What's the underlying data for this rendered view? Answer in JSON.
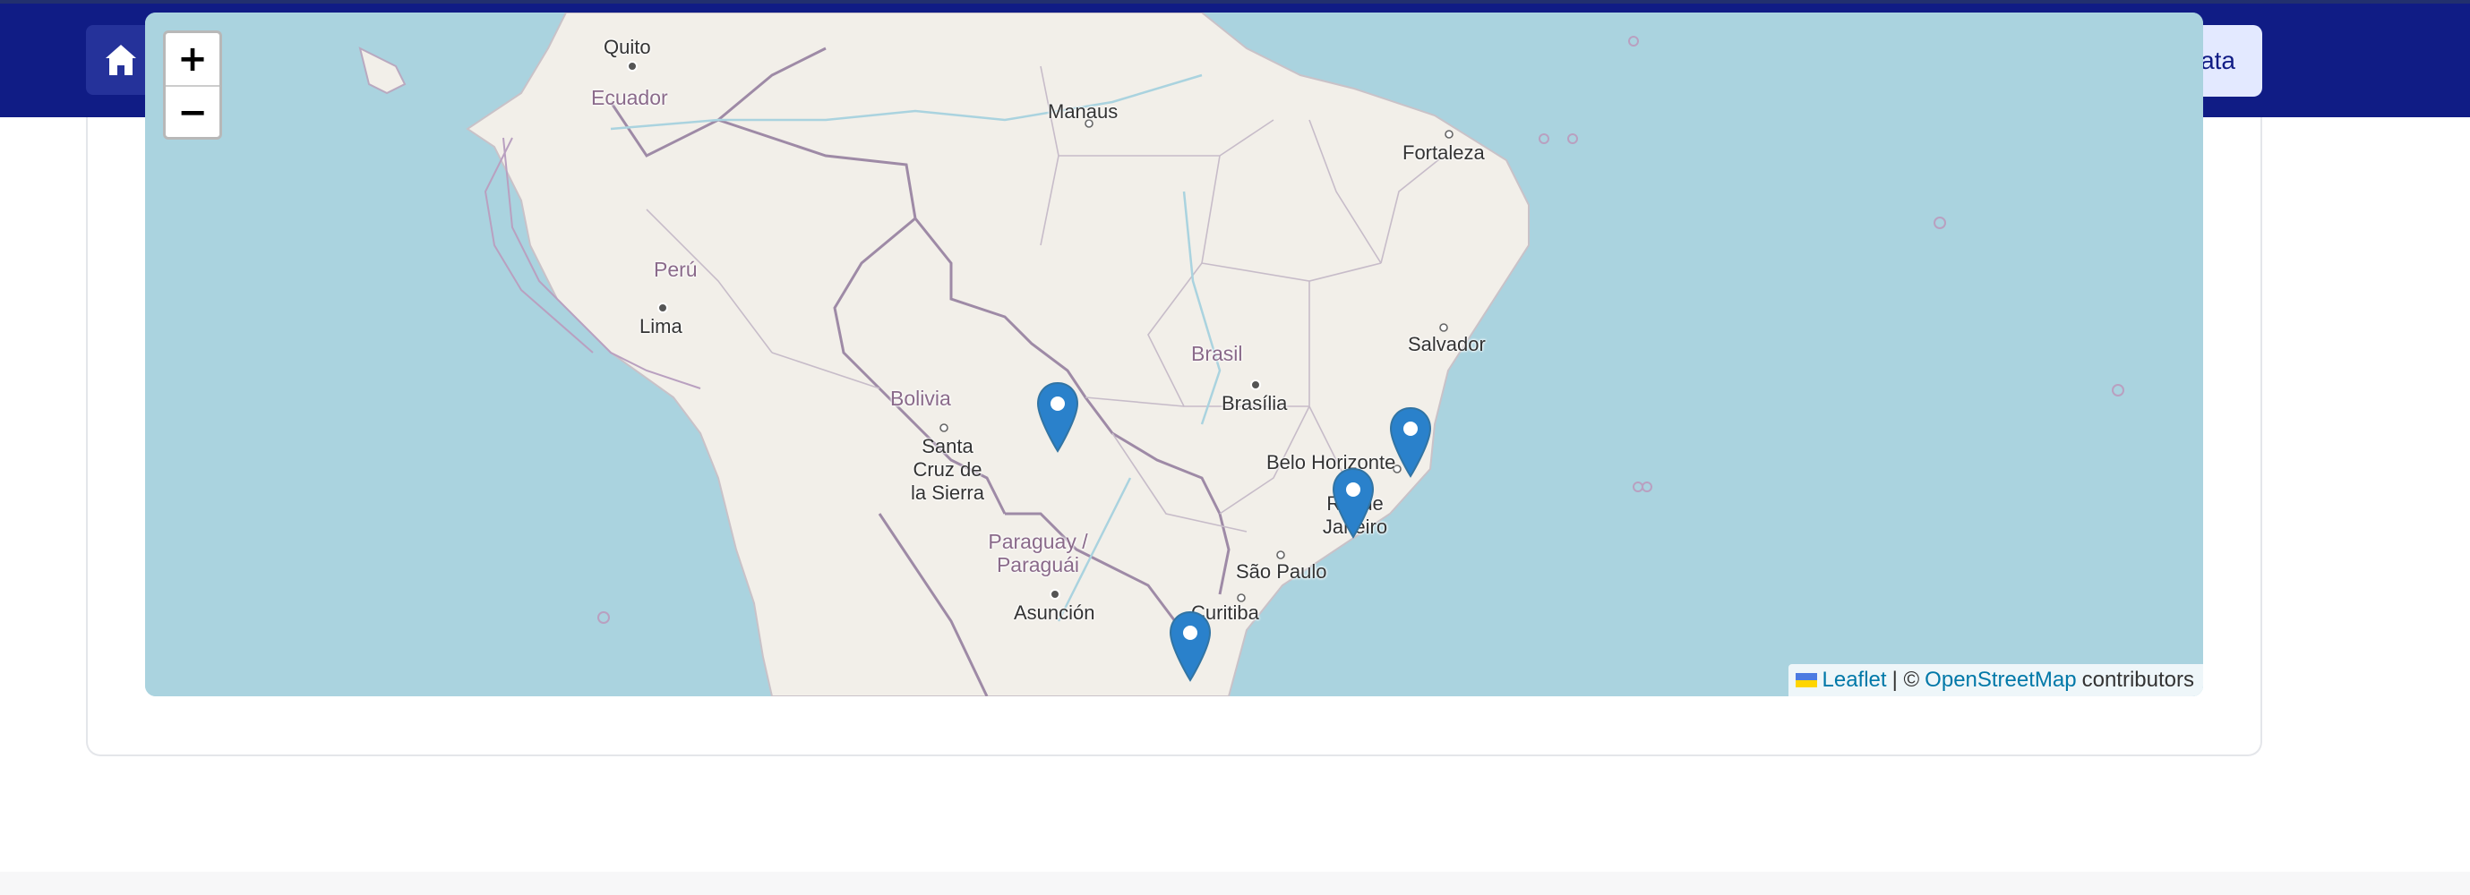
{
  "header": {
    "home_icon": "home-icon",
    "right_button_label": "ata",
    "bar_color": "#101c85"
  },
  "map": {
    "tiles": "OpenStreetMap",
    "zoom_in_label": "+",
    "zoom_out_label": "−",
    "places": {
      "quito": "Quito",
      "ecuador": "Ecuador",
      "manaus": "Manaus",
      "fortaleza": "Fortaleza",
      "peru": "Perú",
      "lima": "Lima",
      "salvador": "Salvador",
      "brasil": "Brasil",
      "brasilia": "Brasília",
      "bolivia": "Bolivia",
      "santa_cruz": "Santa Cruz de la Sierra",
      "belo_horizonte": "Belo Horizonte",
      "rio": "Rio de Janeiro",
      "paraguay": "Paraguay / Paraguái",
      "sao_paulo": "São Paulo",
      "asuncion": "Asunción",
      "curitiba": "Curitiba"
    },
    "markers": [
      {
        "name": "marker-mato-grosso",
        "icon": "map-pin-icon",
        "color": "#2a81cb"
      },
      {
        "name": "marker-espirito-santo",
        "icon": "map-pin-icon",
        "color": "#2a81cb"
      },
      {
        "name": "marker-rio-de-janeiro",
        "icon": "map-pin-icon",
        "color": "#2a81cb"
      },
      {
        "name": "marker-santa-catarina",
        "icon": "map-pin-icon",
        "color": "#2a81cb"
      }
    ],
    "attribution": {
      "leaflet": "Leaflet",
      "separator": "| ©",
      "osm": "OpenStreetMap",
      "contributors": "contributors"
    },
    "colors": {
      "water": "#aad3df",
      "land": "#f2efe9",
      "border": "#9e8aa6"
    }
  }
}
